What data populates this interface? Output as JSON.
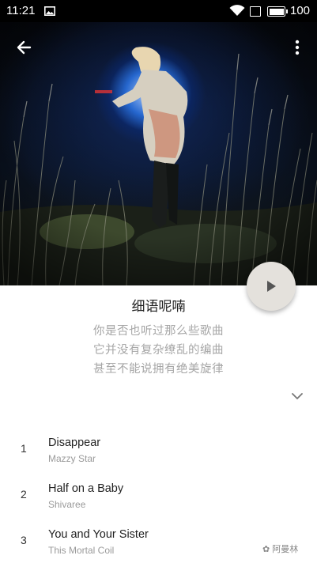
{
  "status_bar": {
    "time": "11:21",
    "battery_percent": "100",
    "battery_level": 1.0,
    "icons": [
      "image-icon",
      "wifi-icon",
      "square-icon",
      "battery-icon"
    ]
  },
  "header": {
    "back_icon": "arrow-left-icon",
    "more_icon": "more-vert-icon"
  },
  "album": {
    "title": "细语呢喃",
    "description_lines": [
      "你是否也听过那么些歌曲",
      "它并没有复杂缭乱的编曲",
      "甚至不能说拥有绝美旋律"
    ],
    "play_icon": "play-icon",
    "expand_icon": "chevron-down-icon"
  },
  "tracks": [
    {
      "number": "1",
      "title": "Disappear",
      "artist": "Mazzy Star"
    },
    {
      "number": "2",
      "title": "Half on a Baby",
      "artist": "Shivaree"
    },
    {
      "number": "3",
      "title": "You and Your Sister",
      "artist": "This Mortal Coil"
    }
  ],
  "watermark": "阿曼林",
  "colors": {
    "fab": "#e4e1dc",
    "glow": "#2a6fd8",
    "muted_text": "#a6a6a6"
  }
}
